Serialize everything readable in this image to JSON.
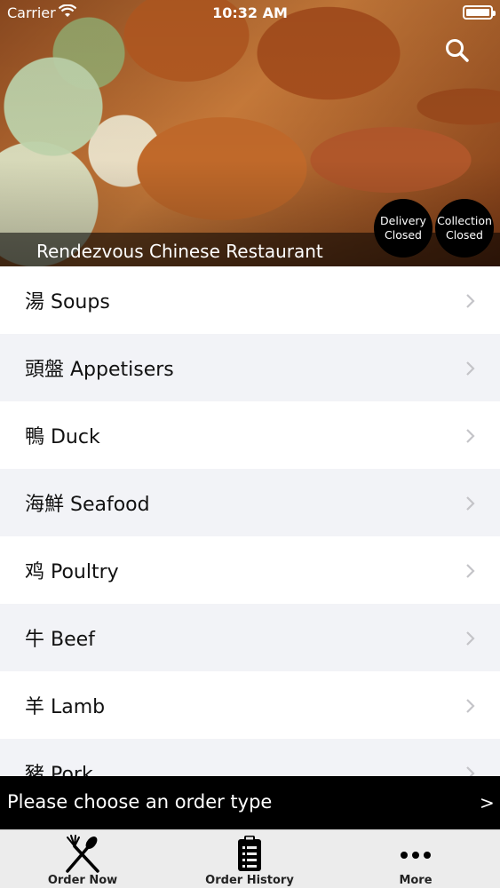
{
  "status_bar": {
    "carrier": "Carrier",
    "time": "10:32 AM"
  },
  "hero": {
    "restaurant_name": "Rendezvous Chinese Restaurant",
    "delivery_badge": {
      "line1": "Delivery",
      "line2": "Closed"
    },
    "collection_badge": {
      "line1": "Collection",
      "line2": "Closed"
    },
    "search_icon": "search-icon"
  },
  "menu": {
    "chevron_icon": "chevron-right-icon",
    "items": [
      {
        "label": "湯 Soups"
      },
      {
        "label": "頭盤  Appetisers"
      },
      {
        "label": "鴨 Duck"
      },
      {
        "label": "海鮮 Seafood"
      },
      {
        "label": "鸡 Poultry"
      },
      {
        "label": "牛 Beef"
      },
      {
        "label": "羊 Lamb"
      },
      {
        "label": "豬 Pork"
      }
    ]
  },
  "order_bar": {
    "message": "Please choose an order type",
    "arrow": ">"
  },
  "tab_bar": {
    "tabs": [
      {
        "label": "Order Now",
        "icon": "fork-knife-icon"
      },
      {
        "label": "Order History",
        "icon": "clipboard-list-icon"
      },
      {
        "label": "More",
        "icon": "more-dots-icon"
      }
    ]
  },
  "colors": {
    "row_alt": "#f2f3f7",
    "bar": "#000000",
    "tab_bar": "#ececec"
  }
}
